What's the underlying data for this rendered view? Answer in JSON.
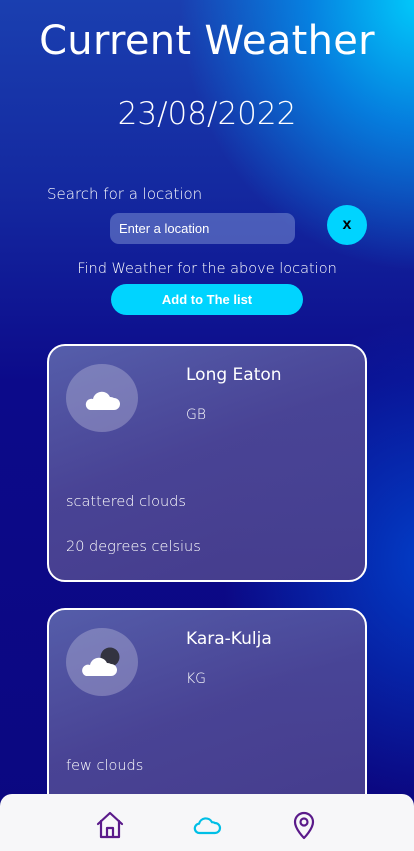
{
  "header": {
    "title": "Current Weather",
    "date": "23/08/2022"
  },
  "search": {
    "label": "Search for a location",
    "placeholder": "Enter a location",
    "value": "",
    "clear_label": "x",
    "find_text": "Find Weather for the above location",
    "add_label": "Add to The list"
  },
  "cards": [
    {
      "city": "Long Eaton",
      "country": "GB",
      "description": "scattered clouds",
      "temperature": "20 degrees celsius",
      "icon": "cloud-icon"
    },
    {
      "city": "Kara-Kulja",
      "country": "KG",
      "description": "few clouds",
      "temperature": "",
      "icon": "cloud-moon-icon"
    }
  ],
  "nav": {
    "items": [
      {
        "icon": "home-icon",
        "active": false
      },
      {
        "icon": "cloud-icon",
        "active": true
      },
      {
        "icon": "location-pin-icon",
        "active": false
      }
    ]
  },
  "colors": {
    "accent": "#00d4ff",
    "nav_icon": "#5a1a8a",
    "nav_active": "#00bfe6",
    "nav_background": "#f7f7f9"
  }
}
